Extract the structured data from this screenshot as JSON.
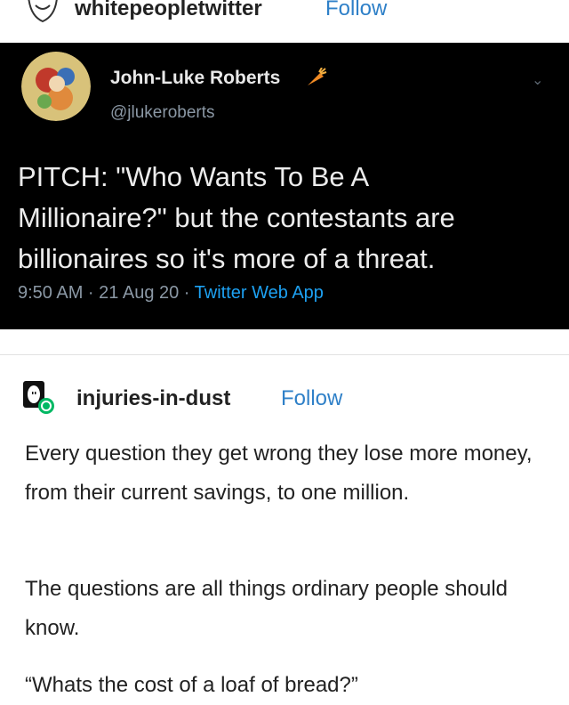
{
  "top_post": {
    "username": "whitepeopletwitter",
    "follow_label": "Follow"
  },
  "tweet": {
    "display_name": "John-Luke Roberts",
    "handle": "@jlukeroberts",
    "text_lines": [
      "PITCH: \"Who Wants To Be A",
      "Millionaire?\" but the contestants are",
      "billionaires so it's more of a threat."
    ],
    "time_date": "9:50 AM · 21 Aug 20 · ",
    "source": "Twitter Web App"
  },
  "reblog": {
    "username": "injuries-in-dust",
    "follow_label": "Follow",
    "paragraphs": [
      "Every question they get wrong they lose more money, from their current savings, to one million.",
      "The questions are all things ordinary people should know.",
      "“Whats the cost of a loaf of bread?”"
    ]
  },
  "colors": {
    "link": "#2f80c8",
    "tweet_bg": "#000000",
    "tweet_source": "#1da1f2"
  }
}
